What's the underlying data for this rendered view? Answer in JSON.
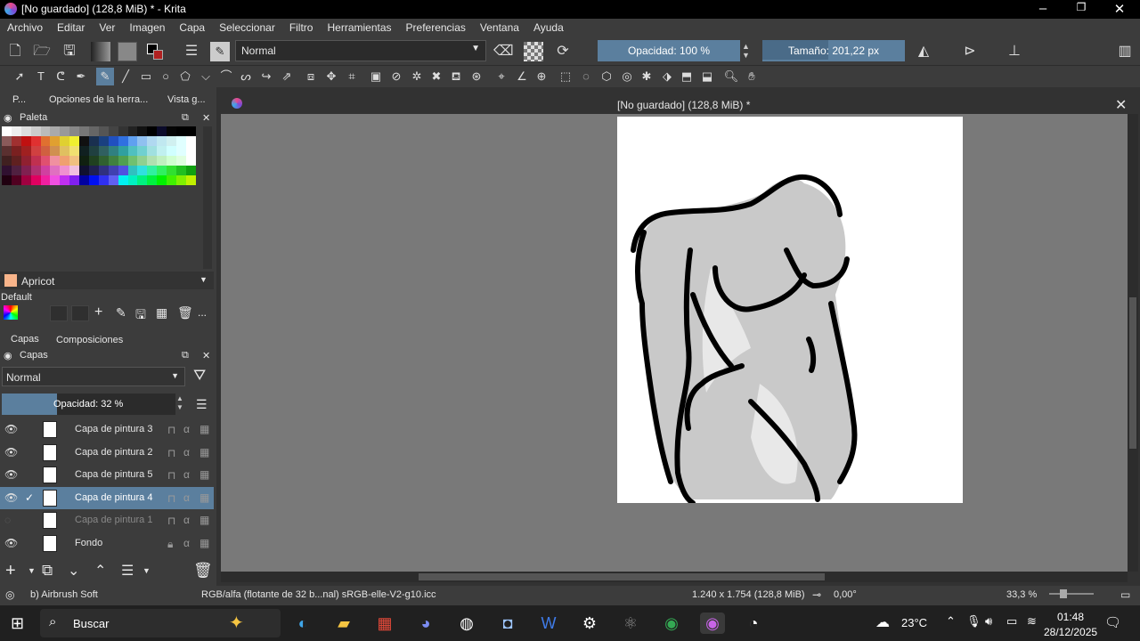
{
  "title": "[No guardado]  (128,8 MiB) * - Krita",
  "menu": [
    "Archivo",
    "Editar",
    "Ver",
    "Imagen",
    "Capa",
    "Seleccionar",
    "Filtro",
    "Herramientas",
    "Preferencias",
    "Ventana",
    "Ayuda"
  ],
  "toolbar": {
    "blend_mode": "Normal",
    "opacity_label": "Opacidad: 100 %",
    "opacity_value": 100,
    "size_label": "Tamaño: 201,22 px",
    "size_fraction": 0.46
  },
  "docker_tabs": [
    "P...",
    "Opciones de la herra...",
    "Vista g..."
  ],
  "palette": {
    "title": "Paleta",
    "selected_color": "Apricot",
    "selected_hex": "#f8b48a",
    "set_name": "Default"
  },
  "layers": {
    "tabs": [
      "Capas",
      "Composiciones"
    ],
    "title": "Capas",
    "blend_mode": "Normal",
    "opacity_label": "Opacidad:  32 %",
    "opacity_value": 32,
    "items": [
      {
        "name": "Capa de pintura 3",
        "visible": true,
        "selected": false
      },
      {
        "name": "Capa de pintura 2",
        "visible": true,
        "selected": false
      },
      {
        "name": "Capa de pintura 5",
        "visible": true,
        "selected": false
      },
      {
        "name": "Capa de pintura 4",
        "visible": true,
        "selected": true
      },
      {
        "name": "Capa de pintura 1",
        "visible": false,
        "selected": false
      },
      {
        "name": "Fondo",
        "visible": true,
        "selected": false
      }
    ]
  },
  "document": {
    "tab_title": "[No guardado]  (128,8 MiB) *"
  },
  "status": {
    "brush": "b) Airbrush Soft",
    "color_profile": "RGB/alfa (flotante de 32 b...nal)  sRGB-elle-V2-g10.icc",
    "dimensions": "1.240 x 1.754 (128,8 MiB)",
    "rotation": "0,00°",
    "zoom": "33,3 %"
  },
  "taskbar": {
    "search_placeholder": "Buscar",
    "temperature": "23°C",
    "time": "01:48",
    "date": "28/12/2025"
  }
}
